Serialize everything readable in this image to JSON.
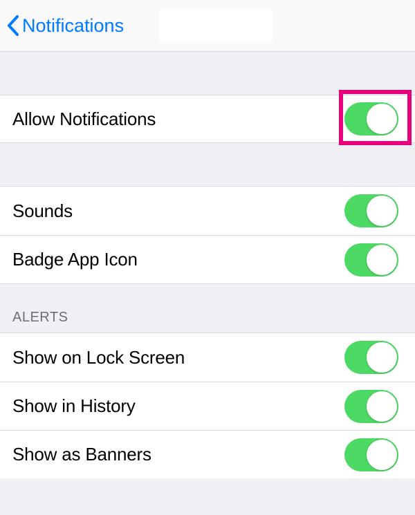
{
  "colors": {
    "accent": "#007AFF",
    "toggle_on": "#4CD964",
    "highlight": "#E6007E",
    "bg": "#EFEFF4",
    "row_bg": "#FFFFFF",
    "separator": "#D9D9DC",
    "header_text": "#6D6D72"
  },
  "nav": {
    "back_label": "Notifications"
  },
  "rows": {
    "allow": {
      "label": "Allow Notifications",
      "on": true,
      "highlighted": true
    },
    "sounds": {
      "label": "Sounds",
      "on": true
    },
    "badge": {
      "label": "Badge App Icon",
      "on": true
    }
  },
  "alerts": {
    "header": "ALERTS",
    "items": [
      {
        "label": "Show on Lock Screen",
        "on": true
      },
      {
        "label": "Show in History",
        "on": true
      },
      {
        "label": "Show as Banners",
        "on": true
      }
    ]
  }
}
